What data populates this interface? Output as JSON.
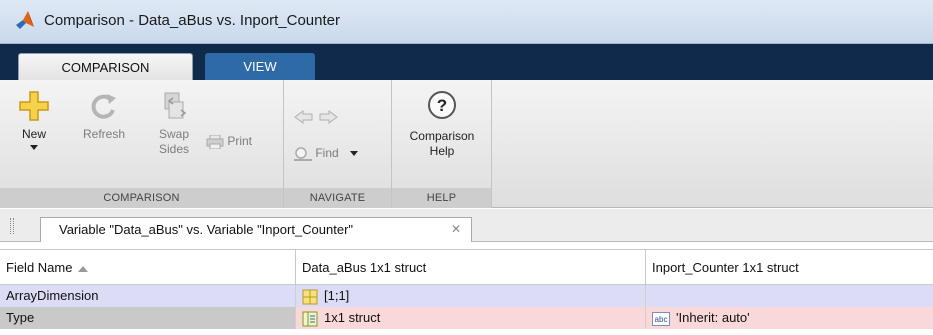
{
  "window": {
    "title": "Comparison - Data_aBus vs. Inport_Counter",
    "logo_icon": "matlab-logo-icon"
  },
  "tabs": [
    {
      "label": "COMPARISON",
      "active": true
    },
    {
      "label": "VIEW",
      "active": false
    }
  ],
  "ribbon": {
    "sections": {
      "comparison": "COMPARISON",
      "navigate": "NAVIGATE",
      "help": "HELP"
    },
    "buttons": {
      "new": "New",
      "refresh": "Refresh",
      "swap_line1": "Swap",
      "swap_line2": "Sides",
      "print": "Print",
      "find": "Find",
      "help_line1": "Comparison",
      "help_line2": "Help"
    }
  },
  "document_tab": {
    "label": "Variable \"Data_aBus\" vs. Variable \"Inport_Counter\""
  },
  "table": {
    "headers": [
      "Field Name",
      "Data_aBus 1x1 struct",
      "Inport_Counter 1x1 struct"
    ],
    "rows": [
      {
        "field": "ArrayDimension",
        "left": "[1;1]",
        "right": ""
      },
      {
        "field": "Type",
        "left": "1x1 struct",
        "right": "'Inherit: auto'"
      }
    ]
  },
  "colors": {
    "row_changed_blue": "#dcdcf6",
    "row_changed_red": "#f8d8d8",
    "tab_active_blue": "#2d6aa6",
    "titlebar_dark": "#0f2a4a"
  }
}
